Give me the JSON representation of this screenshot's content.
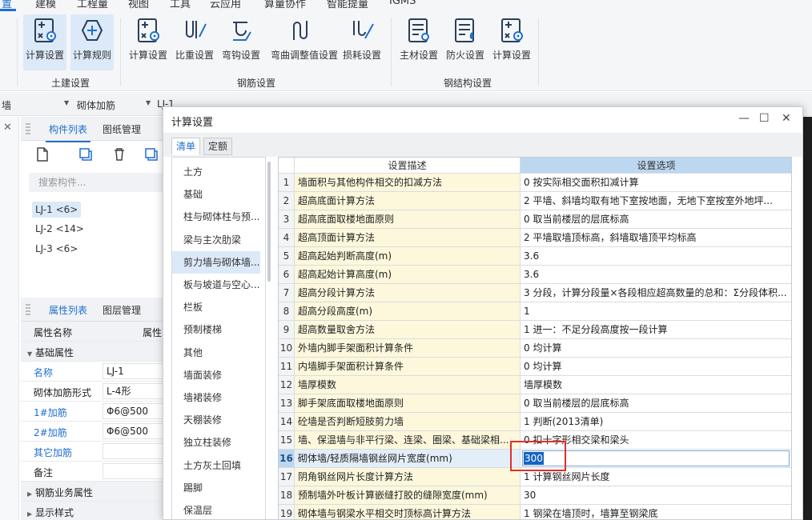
{
  "top_tabs": [
    "置",
    "建模",
    "工程量",
    "视图",
    "工具",
    "云应用",
    "算量协作",
    "智能提量",
    "IGMS"
  ],
  "ribbon": {
    "left_partial_label": "置",
    "civil": {
      "group_label": "土建设置",
      "buttons": [
        {
          "label": "计算设置",
          "icon": "calc-settings-icon"
        },
        {
          "label": "计算规则",
          "icon": "calc-rules-icon"
        }
      ]
    },
    "rebar": {
      "group_label": "钢筋设置",
      "buttons": [
        {
          "label": "计算设置",
          "icon": "calc-settings-icon"
        },
        {
          "label": "比重设置",
          "icon": "weight-settings-icon"
        },
        {
          "label": "弯钩设置",
          "icon": "hook-settings-icon"
        },
        {
          "label": "弯曲调整值设置",
          "icon": "bend-adjust-icon"
        },
        {
          "label": "损耗设置",
          "icon": "loss-settings-icon"
        }
      ]
    },
    "steel": {
      "group_label": "钢结构设置",
      "buttons": [
        {
          "label": "主材设置",
          "icon": "main-material-icon"
        },
        {
          "label": "防火设置",
          "icon": "fireproof-icon"
        },
        {
          "label": "计算设置",
          "icon": "calc-settings-icon"
        }
      ]
    }
  },
  "filterbar": {
    "item1": "墙",
    "item2": "砌体加筋",
    "item3": "LJ-1"
  },
  "component_panel": {
    "tabs": [
      "构件列表",
      "图纸管理"
    ],
    "search_placeholder": "搜索构件...",
    "items": [
      "LJ-1 <6>",
      "LJ-2 <14>",
      "LJ-3 <6>"
    ]
  },
  "property_panel": {
    "tabs": [
      "属性列表",
      "图层管理"
    ],
    "header_name": "属性名称",
    "header_value": "属性",
    "group_basic": "基础属性",
    "rows": [
      {
        "name": "名称",
        "value": "LJ-1"
      },
      {
        "name": "砌体加筋形式",
        "value": "L-4形"
      },
      {
        "name": "1#加筋",
        "value": "Φ6@500"
      },
      {
        "name": "2#加筋",
        "value": "Φ6@500"
      },
      {
        "name": "其它加筋",
        "value": ""
      },
      {
        "name": "备注",
        "value": ""
      }
    ],
    "group_rebar": "钢筋业务属性",
    "group_display": "显示样式"
  },
  "dialog": {
    "title": "计算设置",
    "tabs": [
      "清单",
      "定额"
    ],
    "categories": [
      "土方",
      "基础",
      "柱与砌体柱与预...",
      "梁与主次肋梁",
      "剪力墙与砌体墙...",
      "板与坡道与空心...",
      "栏板",
      "预制楼梯",
      "其他",
      "墙面装修",
      "墙裙装修",
      "天棚装修",
      "独立柱装修",
      "土方灰土回填",
      "踢脚",
      "保温层"
    ],
    "selected_category": 4,
    "header_desc": "设置描述",
    "header_opt": "设置选项",
    "rows": [
      {
        "n": "1",
        "desc": "墙面积与其他构件相交的扣减方法",
        "val": "0 按实际相交面积扣减计算"
      },
      {
        "n": "2",
        "desc": "超高底面计算方法",
        "val": "2 平墙、斜墙均取有地下室按地面，无地下室按室外地坪..."
      },
      {
        "n": "3",
        "desc": "超高底面取楼地面原则",
        "val": "0 取当前楼层的层底标高"
      },
      {
        "n": "4",
        "desc": "超高顶面计算方法",
        "val": "2 平墙取墙顶标高，斜墙取墙顶平均标高"
      },
      {
        "n": "5",
        "desc": "超高起始判断高度(m)",
        "val": "3.6"
      },
      {
        "n": "6",
        "desc": "超高起始计算高度(m)",
        "val": "3.6"
      },
      {
        "n": "7",
        "desc": "超高分段计算方法",
        "val": "3 分段，计算分段量×各段相应超高数量的总和：Σ分段体积..."
      },
      {
        "n": "8",
        "desc": "超高分段高度(m)",
        "val": "1"
      },
      {
        "n": "9",
        "desc": "超高数量取舍方法",
        "val": "1 进一：不足分段高度按一段计算"
      },
      {
        "n": "10",
        "desc": "外墙内脚手架面积计算条件",
        "val": "0 均计算"
      },
      {
        "n": "11",
        "desc": "内墙脚手架面积计算条件",
        "val": "0 均计算"
      },
      {
        "n": "12",
        "desc": "墙厚模数",
        "val": "墙厚模数"
      },
      {
        "n": "13",
        "desc": "脚手架底面取楼地面原则",
        "val": "0 取当前楼层的层底标高"
      },
      {
        "n": "14",
        "desc": "砼墙是否判断短肢剪力墙",
        "val": "1 判断(2013清单)"
      },
      {
        "n": "15",
        "desc": "墙、保温墙与非平行梁、连梁、圈梁、基础梁相...",
        "val": "0 扣十字形相交梁和梁头"
      },
      {
        "n": "16",
        "desc": "砌体墙/轻质隔墙钢丝网片宽度(mm)",
        "val": "300"
      },
      {
        "n": "17",
        "desc": "阴角钢丝网片长度计算方法",
        "val": "1 计算钢丝网片长度"
      },
      {
        "n": "18",
        "desc": "预制墙外叶板计算嵌缝打胶的缝隙宽度(mm)",
        "val": "30"
      },
      {
        "n": "19",
        "desc": "砌体墙与钢梁水平相交时顶标高计算方法",
        "val": "1 钢梁在墙顶时，墙算至钢梁底"
      }
    ],
    "selected_row": 15
  }
}
